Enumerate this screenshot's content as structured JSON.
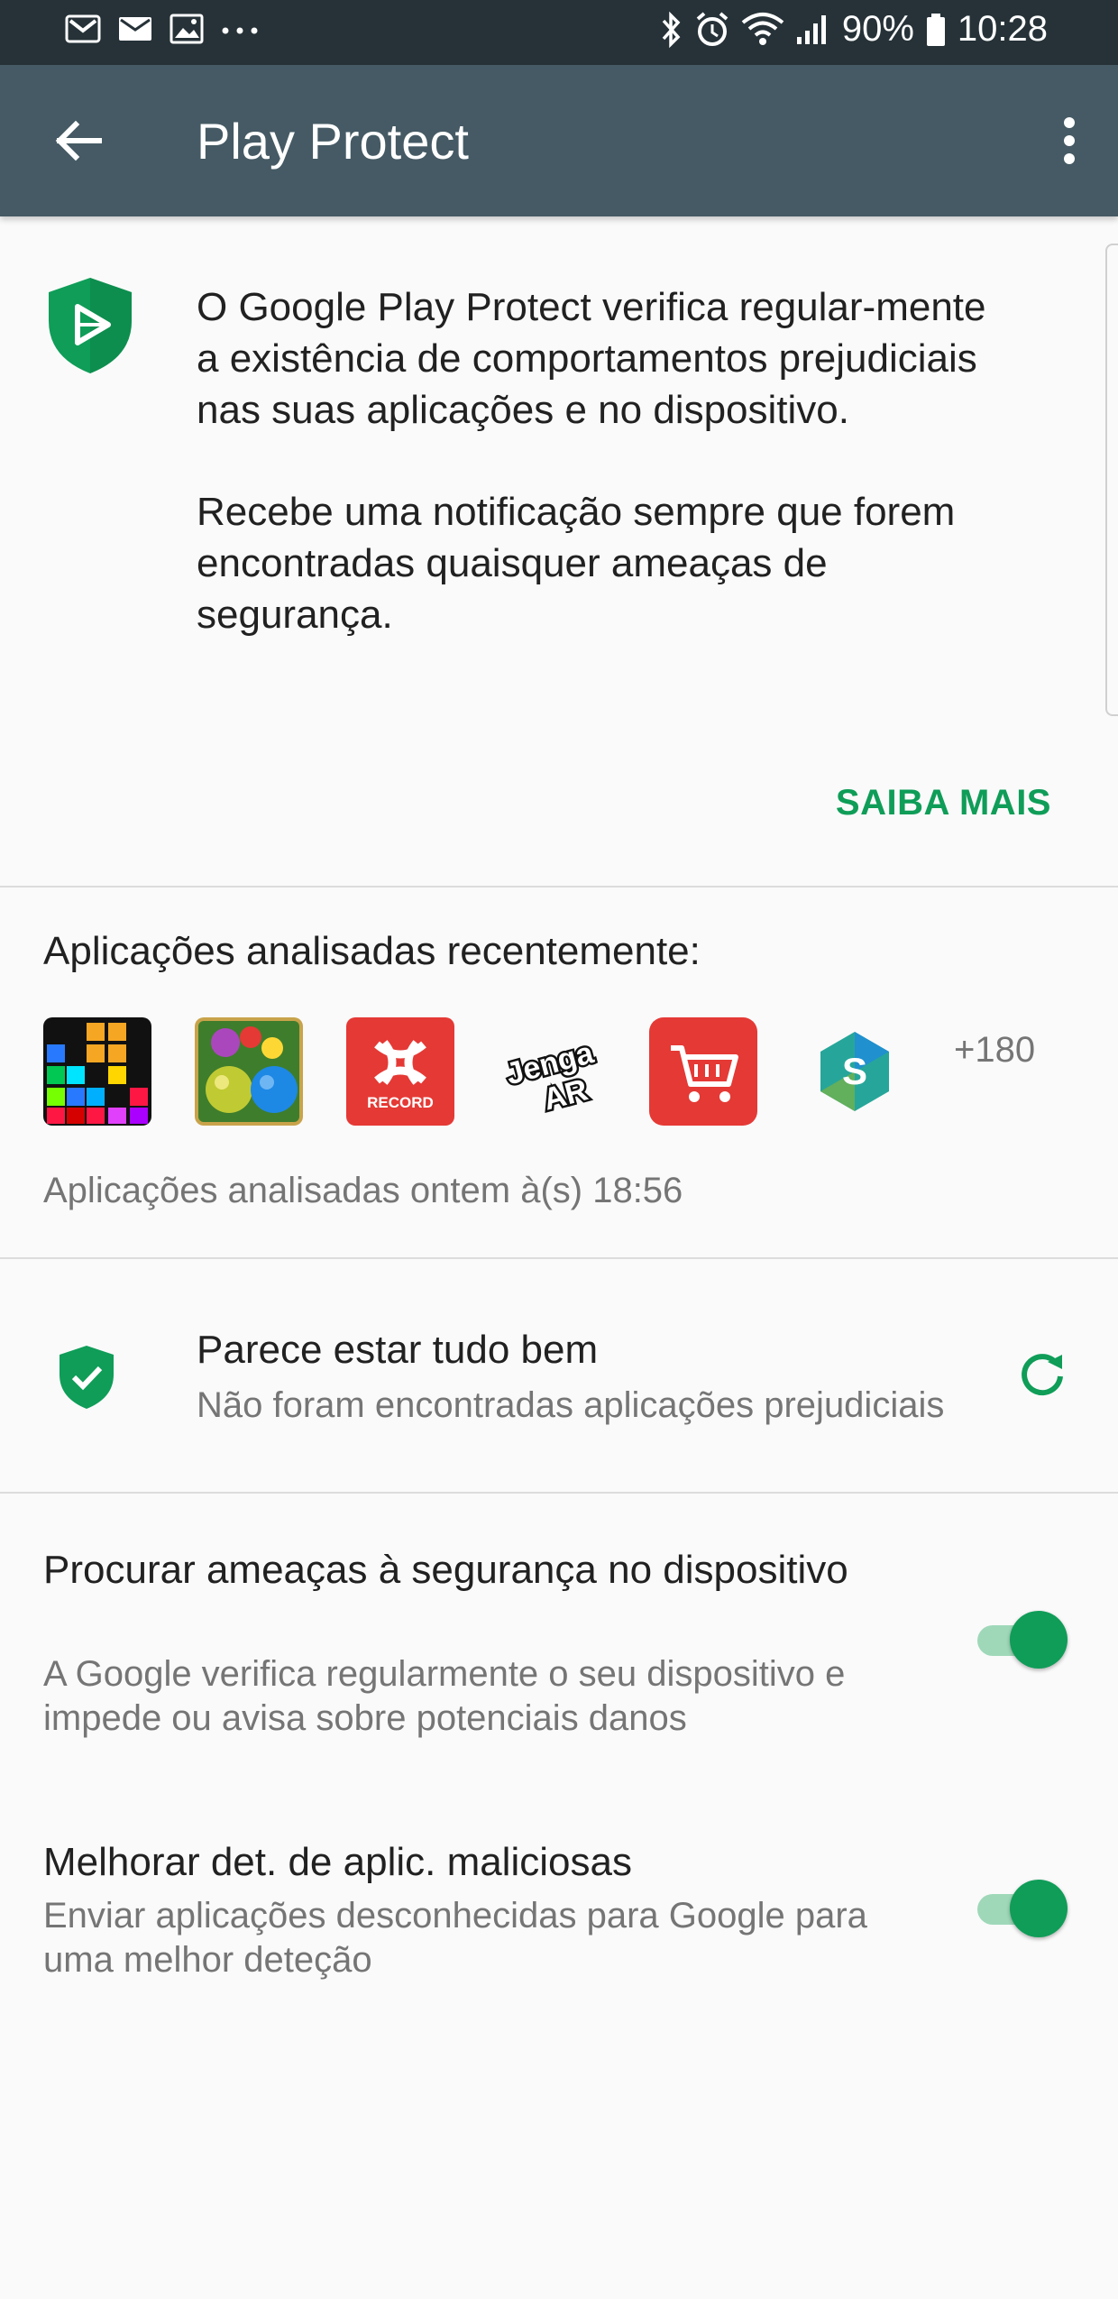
{
  "status_bar": {
    "battery": "90%",
    "time": "10:28",
    "left_icons": [
      "gmail-icon",
      "email-icon",
      "gallery-icon",
      "more-dots-icon"
    ],
    "right_icons": [
      "bluetooth-icon",
      "alarm-icon",
      "wifi-icon",
      "signal-icon",
      "battery-icon"
    ]
  },
  "app_bar": {
    "title": "Play Protect"
  },
  "intro": {
    "paragraph1": "O Google Play Protect verifica regular-mente a existência de comportamentos prejudiciais nas suas aplicações e no dispositivo.",
    "paragraph2": "Recebe uma notificação sempre que forem encontradas quaisquer ameaças de segurança.",
    "learn_more": "SAIBA MAIS"
  },
  "recent": {
    "heading": "Aplicações analisadas recentemente:",
    "apps": [
      {
        "icon": "block-puzzle-app-icon"
      },
      {
        "icon": "marble-game-app-icon"
      },
      {
        "icon": "under-armour-record-app-icon",
        "label": "RECORD"
      },
      {
        "icon": "jenga-ar-app-icon",
        "label": "Jenga AR"
      },
      {
        "icon": "shopping-cart-app-icon"
      },
      {
        "icon": "s-hexagon-app-icon",
        "label": "S"
      }
    ],
    "more": "+180",
    "scan_time": "Aplicações analisadas ontem à(s) 18:56"
  },
  "status": {
    "title": "Parece estar tudo bem",
    "subtitle": "Não foram encontradas aplicações prejudiciais"
  },
  "settings": [
    {
      "title": "Procurar ameaças à segurança no dispositivo",
      "desc": "A Google verifica regularmente o seu dispositivo e impede ou avisa sobre potenciais danos",
      "enabled": true
    },
    {
      "title": "Melhorar det. de aplic. maliciosas",
      "desc": "Enviar aplicações desconhecidas para Google para uma melhor deteção",
      "enabled": true
    }
  ],
  "colors": {
    "app_bar": "#455a64",
    "status_bar": "#263238",
    "accent": "#0f9d58"
  }
}
